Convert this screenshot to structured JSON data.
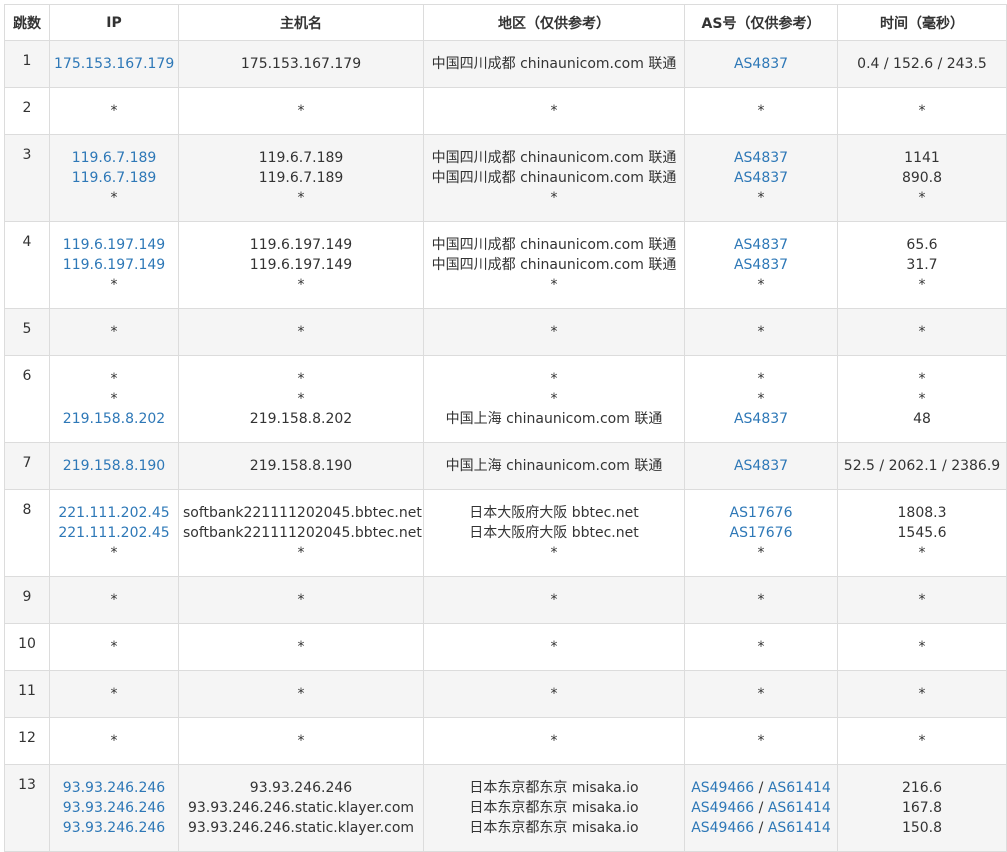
{
  "colors": {
    "link": "#2e78b7",
    "text": "#333333",
    "border": "#dcdcdc",
    "odd_row_bg": "#f5f5f5"
  },
  "table": {
    "headers": [
      "跳数",
      "IP",
      "主机名",
      "地区（仅供参考）",
      "AS号（仅供参考）",
      "时间（毫秒）"
    ],
    "rows": [
      {
        "hop": "1",
        "ip": [
          "175.153.167.179"
        ],
        "host": [
          "175.153.167.179"
        ],
        "region": [
          "中国四川成都 chinaunicom.com 联通"
        ],
        "asn": [
          [
            "AS4837"
          ]
        ],
        "time": [
          "0.4 / 152.6 / 243.5"
        ]
      },
      {
        "hop": "2",
        "ip": [
          "*"
        ],
        "host": [
          "*"
        ],
        "region": [
          "*"
        ],
        "asn": [
          [
            "*"
          ]
        ],
        "time": [
          "*"
        ]
      },
      {
        "hop": "3",
        "ip": [
          "119.6.7.189",
          "119.6.7.189",
          "*"
        ],
        "host": [
          "119.6.7.189",
          "119.6.7.189",
          "*"
        ],
        "region": [
          "中国四川成都 chinaunicom.com 联通",
          "中国四川成都 chinaunicom.com 联通",
          "*"
        ],
        "asn": [
          [
            "AS4837"
          ],
          [
            "AS4837"
          ],
          [
            "*"
          ]
        ],
        "time": [
          "1141",
          "890.8",
          "*"
        ]
      },
      {
        "hop": "4",
        "ip": [
          "119.6.197.149",
          "119.6.197.149",
          "*"
        ],
        "host": [
          "119.6.197.149",
          "119.6.197.149",
          "*"
        ],
        "region": [
          "中国四川成都 chinaunicom.com 联通",
          "中国四川成都 chinaunicom.com 联通",
          "*"
        ],
        "asn": [
          [
            "AS4837"
          ],
          [
            "AS4837"
          ],
          [
            "*"
          ]
        ],
        "time": [
          "65.6",
          "31.7",
          "*"
        ]
      },
      {
        "hop": "5",
        "ip": [
          "*"
        ],
        "host": [
          "*"
        ],
        "region": [
          "*"
        ],
        "asn": [
          [
            "*"
          ]
        ],
        "time": [
          "*"
        ]
      },
      {
        "hop": "6",
        "ip": [
          "*",
          "*",
          "219.158.8.202"
        ],
        "host": [
          "*",
          "*",
          "219.158.8.202"
        ],
        "region": [
          "*",
          "*",
          "中国上海 chinaunicom.com 联通"
        ],
        "asn": [
          [
            "*"
          ],
          [
            "*"
          ],
          [
            "AS4837"
          ]
        ],
        "time": [
          "*",
          "*",
          "48"
        ]
      },
      {
        "hop": "7",
        "ip": [
          "219.158.8.190"
        ],
        "host": [
          "219.158.8.190"
        ],
        "region": [
          "中国上海 chinaunicom.com 联通"
        ],
        "asn": [
          [
            "AS4837"
          ]
        ],
        "time": [
          "52.5 / 2062.1 / 2386.9"
        ]
      },
      {
        "hop": "8",
        "ip": [
          "221.111.202.45",
          "221.111.202.45",
          "*"
        ],
        "host": [
          "softbank221111202045.bbtec.net",
          "softbank221111202045.bbtec.net",
          "*"
        ],
        "region": [
          "日本大阪府大阪 bbtec.net",
          "日本大阪府大阪 bbtec.net",
          "*"
        ],
        "asn": [
          [
            "AS17676"
          ],
          [
            "AS17676"
          ],
          [
            "*"
          ]
        ],
        "time": [
          "1808.3",
          "1545.6",
          "*"
        ]
      },
      {
        "hop": "9",
        "ip": [
          "*"
        ],
        "host": [
          "*"
        ],
        "region": [
          "*"
        ],
        "asn": [
          [
            "*"
          ]
        ],
        "time": [
          "*"
        ]
      },
      {
        "hop": "10",
        "ip": [
          "*"
        ],
        "host": [
          "*"
        ],
        "region": [
          "*"
        ],
        "asn": [
          [
            "*"
          ]
        ],
        "time": [
          "*"
        ]
      },
      {
        "hop": "11",
        "ip": [
          "*"
        ],
        "host": [
          "*"
        ],
        "region": [
          "*"
        ],
        "asn": [
          [
            "*"
          ]
        ],
        "time": [
          "*"
        ]
      },
      {
        "hop": "12",
        "ip": [
          "*"
        ],
        "host": [
          "*"
        ],
        "region": [
          "*"
        ],
        "asn": [
          [
            "*"
          ]
        ],
        "time": [
          "*"
        ]
      },
      {
        "hop": "13",
        "ip": [
          "93.93.246.246",
          "93.93.246.246",
          "93.93.246.246"
        ],
        "host": [
          "93.93.246.246",
          "93.93.246.246.static.klayer.com",
          "93.93.246.246.static.klayer.com"
        ],
        "region": [
          "日本东京都东京 misaka.io",
          "日本东京都东京 misaka.io",
          "日本东京都东京 misaka.io"
        ],
        "asn": [
          [
            "AS49466",
            "AS61414"
          ],
          [
            "AS49466",
            "AS61414"
          ],
          [
            "AS49466",
            "AS61414"
          ]
        ],
        "time": [
          "216.6",
          "167.8",
          "150.8"
        ]
      }
    ]
  }
}
